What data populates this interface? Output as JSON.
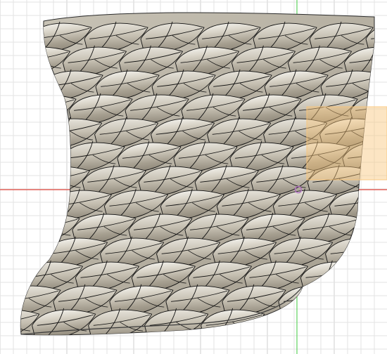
{
  "viewport": {
    "background_color": "#ffffff",
    "grid_color": "#e3e3e3",
    "grid_major_color": "#cfcfcf",
    "x_axis_color": "#e0463c",
    "y_axis_color": "#5fd35f",
    "origin_marker_color": "#b070c0",
    "selection_box_color": "#f9c57a"
  },
  "model": {
    "type": "scaled-panel-surface",
    "surface_base_color": "#c9c3b4",
    "surface_shadow_color": "#8d8678",
    "surface_highlight_color": "#f5f4f0",
    "edge_color": "#111111"
  },
  "icons": {
    "origin": "origin-point-icon"
  }
}
